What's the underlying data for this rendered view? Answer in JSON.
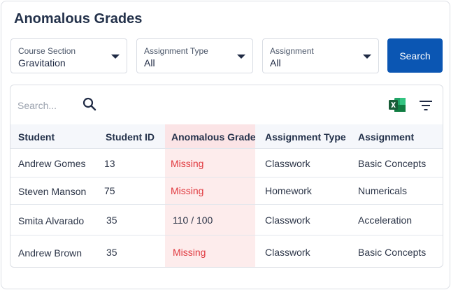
{
  "page": {
    "title": "Anomalous Grades"
  },
  "filters": {
    "course_section": {
      "label": "Course Section",
      "value": "Gravitation"
    },
    "assignment_type": {
      "label": "Assignment Type",
      "value": "All"
    },
    "assignment": {
      "label": "Assignment",
      "value": "All"
    },
    "search_label": "Search"
  },
  "table": {
    "search_placeholder": "Search...",
    "columns": [
      "Student",
      "Student ID",
      "Anomalous Grade",
      "Assignment Type",
      "Assignment"
    ],
    "rows": [
      {
        "student": "Andrew Gomes",
        "id": "13",
        "grade": "Missing",
        "type": "Classwork",
        "assignment": "Basic Concepts"
      },
      {
        "student": "Steven Manson",
        "id": "75",
        "grade": "Missing",
        "type": "Homework",
        "assignment": "Numericals"
      },
      {
        "student": "Smita Alvarado",
        "id": "35",
        "grade": "110 / 100",
        "type": "Classwork",
        "assignment": "Acceleration"
      },
      {
        "student": "Andrew Brown",
        "id": "35",
        "grade": "Missing",
        "type": "Classwork",
        "assignment": "Basic Concepts"
      }
    ]
  },
  "colors": {
    "primary": "#0b56b3",
    "anomaly_highlight": "#fdecec",
    "missing_text": "#e0383e",
    "excel_green": "#1e7145"
  },
  "icons": [
    "search-icon",
    "excel-icon",
    "filter-icon",
    "chevron-down-icon"
  ]
}
